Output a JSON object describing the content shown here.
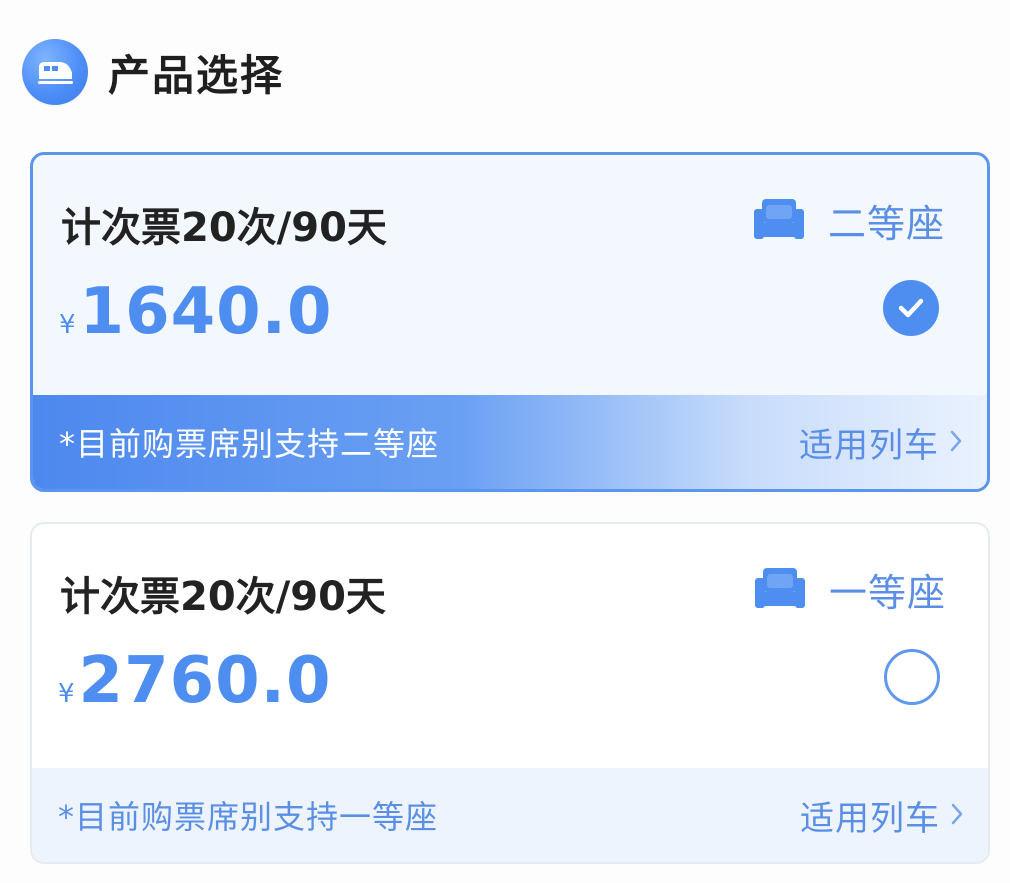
{
  "header": {
    "title": "产品选择",
    "icon": "train-icon"
  },
  "products": [
    {
      "title": "计次票20次/90天",
      "seat_icon": "seat-icon",
      "seat_label": "二等座",
      "currency": "¥",
      "price": "1640.0",
      "selected": true,
      "note": "*目前购票席别支持二等座",
      "link_label": "适用列车"
    },
    {
      "title": "计次票20次/90天",
      "seat_icon": "seat-icon",
      "seat_label": "一等座",
      "currency": "¥",
      "price": "2760.0",
      "selected": false,
      "note": "*目前购票席别支持一等座",
      "link_label": "适用列车"
    }
  ],
  "colors": {
    "accent": "#4d8ef0",
    "accent_border": "#5b95ee",
    "text_dark": "#222222",
    "selected_bg": "#f3f7fe"
  }
}
